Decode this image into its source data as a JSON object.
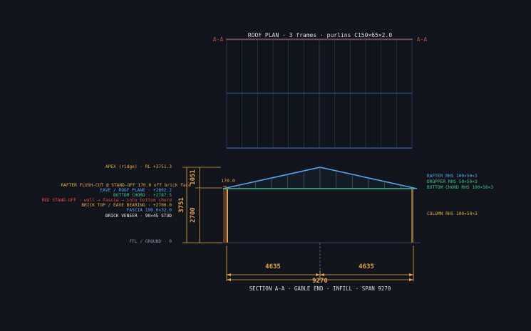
{
  "plan": {
    "title": "ROOF PLAN · 3 frames · purlins C150×65×2.0",
    "section_marker_left": "A-A",
    "section_marker_right": "A-A"
  },
  "labels_left": [
    {
      "text": "APEX (ridge) · RL +3751.3",
      "color": "#e0a64a"
    },
    {
      "text": "RAFTER FLUSH-CUT @ STAND-OFF 170.0 off brick face",
      "color": "#e0a64a"
    },
    {
      "text": "EAVE / ROOF PLANE · +2802.2",
      "color": "#5aa0e6"
    },
    {
      "text": "BOTTOM CHORD · +2787.5",
      "color": "#3fbf8a"
    },
    {
      "text": "RED STAND-OFF · wall → fascia → into bottom chord",
      "color": "#e04848"
    },
    {
      "text": "BRICK TOP / EAVE BEARING · +2700.0",
      "color": "#e0a64a"
    },
    {
      "text": "FASCIA 190.0×32.0",
      "color": "#5aa0e6"
    },
    {
      "text": "BRICK VENEER · 90×45 STUD",
      "color": "#e8e8e8"
    },
    {
      "text": "FFL / GROUND · 0",
      "color": "#8a8f99"
    }
  ],
  "labels_right": [
    {
      "text": "RAFTER RHS 100×50×3",
      "color": "#5aa0e6"
    },
    {
      "text": "DROPPER RHS 50×50×3",
      "color": "#3fbf8a"
    },
    {
      "text": "BOTTOM CHORD RHS 100×50×3",
      "color": "#3fbf8a"
    },
    {
      "text": "COLUMN RHS 100×50×3",
      "color": "#e0a64a"
    }
  ],
  "dimensions": {
    "standoff": "170.0",
    "total_height": "3751",
    "roof_rise": "1051",
    "wall_height": "2700",
    "half_span_left": "4635",
    "half_span_right": "4635",
    "span": "9270"
  },
  "section": {
    "title": "SECTION A-A · GABLE END · INFILL · SPAN 9270"
  },
  "colors": {
    "background": "#12151b",
    "dimension": "#e0a64a",
    "rafter": "#5aa0e6",
    "chord": "#3fbf8a",
    "standoff": "#e04848",
    "grid": "#2a4a6a",
    "plan_edge": "#c0504a"
  }
}
